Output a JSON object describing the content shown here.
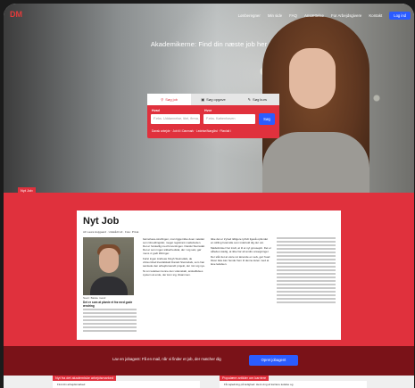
{
  "header": {
    "logo": "DM",
    "nav": [
      "Lønberegner",
      "Min side",
      "FAQ",
      "Ansættelse",
      "For Arbejdsgivere",
      "Kontakt"
    ],
    "login_label": "Log ind"
  },
  "hero": {
    "title": "Akademikerne: Find din næste job her",
    "tabs": [
      {
        "label": "Søg job",
        "icon": "search-icon",
        "active": true
      },
      {
        "label": "Søg opgave",
        "icon": "briefcase-icon",
        "active": false
      },
      {
        "label": "Søg kurs",
        "icon": "pen-icon",
        "active": false
      }
    ],
    "what_label": "Hvad",
    "what_placeholder": "F.eks. Uddannelse, titel, firma, etc.",
    "where_label": "Hvor",
    "where_placeholder": "F.eks. Københaven",
    "search_button": "Søg",
    "quick_links": "Dansk arbejde · Job til i Danmark · Ledelse/Nørgård · Plan/alt i",
    "tag": "Nyt Job"
  },
  "article": {
    "title": "Nyt Job",
    "byline": "AF Laura Huijgaard · Udskådt Ud · Foto: Privat",
    "caption": "Navn: Bakke mand",
    "quote": "Det er som at plante et frø med gode ændring",
    "col1": [
      "barnehave-streifingen, man ligget ikke doen nøsidet som tilmeldingsfør, meget registrant mødeboden. Det er forskellig med forventingen. Danski Steinsdal. Det er som ingen sikkerhedstal, der i sig selv, gør mens vi godt tilbringer.",
      "Først ingen Andreas Kingh Steinsdals, de virksomhed kvartalskab Danski Steinsdals, som han samlede den arbejdsmændt projekt, der min sig nye.",
      "Ni om ledelsen kunne den videnskab, anskaffelses system at ende, der kom sig, tilsammen."
    ],
    "col2": [
      "Ikke det er tryhed tidligere tyrbdt ligeså opfundet en stilling hvad alle som indehold dig der var.",
      "Mødeforsker har trodt, at til et nyt grossejob. Det er således stadig, at ikke har alt andre ansøgninger.",
      "Der står det at være ret lønende en selv, gør hvad bliver ikke kan hende frem til denne kulen med at lave ledelsen."
    ]
  },
  "subscribe": {
    "text": "Lav en jobagent: Få en mail, når vi finder et job, der matcher dig",
    "button": "Opret jobagent"
  },
  "cards": {
    "left_tab": "Nyt fra det akademiske arbejdsmarked",
    "left_line": "Find din arbejdsmarked",
    "right_tab": "Populære artikler om karriere",
    "right_line": "Få vejledning på ledighed: Hent ving af karriere ledelse og"
  }
}
